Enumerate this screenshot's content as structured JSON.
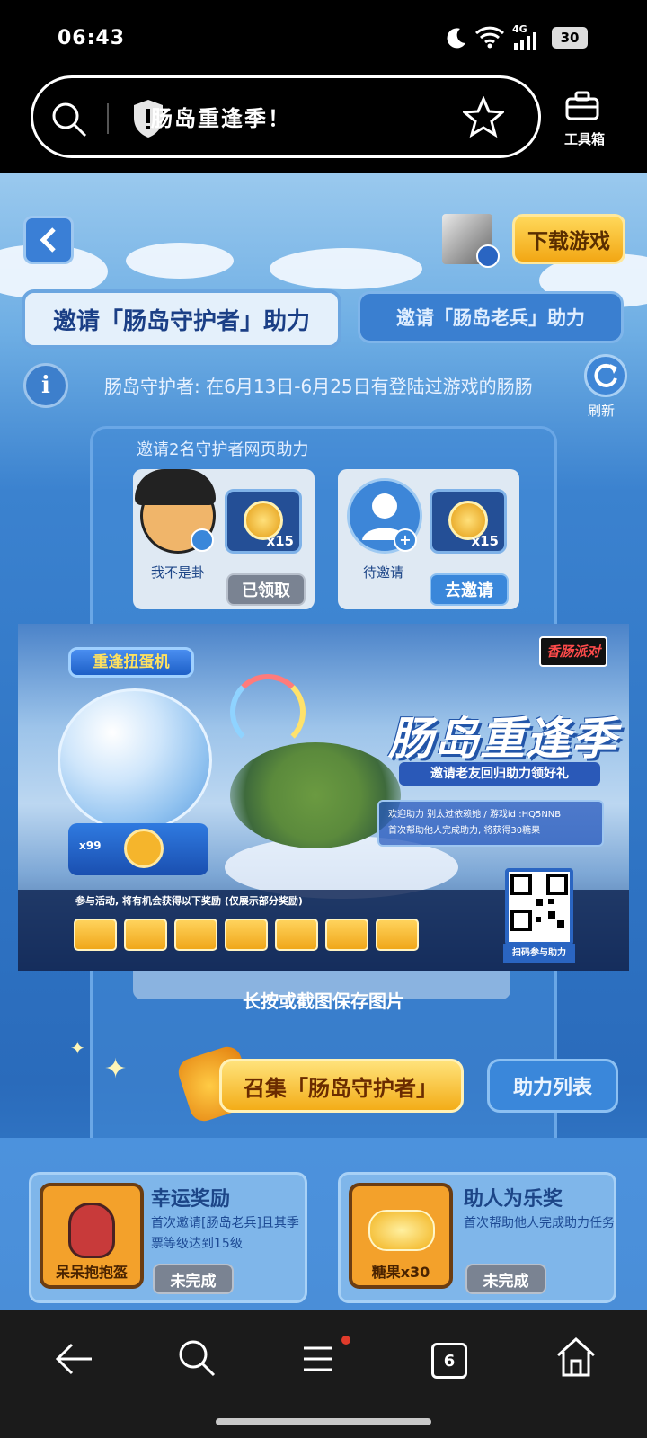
{
  "status_bar": {
    "time": "06:43",
    "network": "4G",
    "battery": "30"
  },
  "browser": {
    "address_text": "肠岛重逢季！",
    "toolbox_label": "工具箱"
  },
  "header": {
    "download_label": "下载游戏"
  },
  "tabs": [
    {
      "label": "邀请「肠岛守护者」助力",
      "active": true
    },
    {
      "label": "邀请「肠岛老兵」助力",
      "active": false
    }
  ],
  "info": {
    "text": "肠岛守护者: 在6月13日-6月25日有登陆过游戏的肠肠",
    "refresh_label": "刷新"
  },
  "invite_card": {
    "title": "邀请2名守护者网页助力",
    "slots": [
      {
        "name": "我不是卦",
        "reward_count": "x15",
        "button": "已领取",
        "done": true
      },
      {
        "name": "待邀请",
        "reward_count": "x15",
        "button": "去邀请",
        "done": false
      }
    ],
    "save_hint": "长按或截图保存图片"
  },
  "poster": {
    "logo": "香肠派对",
    "title": "肠岛重逢季",
    "subtitle": "邀请老友回归助力领好礼",
    "info_line1": "欢迎助力 别太过依赖她 / 游戏id :HQ5NNB",
    "info_line2": "首次帮助他人完成助力, 将获得30糖果",
    "gacha_label": "重逢扭蛋机",
    "gacha_counter": "x99",
    "rewards_note": "参与活动, 将有机会获得以下奖励 (仅展示部分奖励)",
    "qr_label": "扫码参与助力"
  },
  "actions": {
    "gather_label": "召集「肠岛守护者」",
    "help_list_label": "助力列表"
  },
  "bonus_panels": [
    {
      "title": "幸运奖励",
      "prize_label": "呆呆抱抱盔",
      "description": "首次邀请[肠岛老兵]且其季票等级达到15级",
      "status": "未完成"
    },
    {
      "title": "助人为乐奖",
      "prize_label": "糖果x30",
      "description": "首次帮助他人完成助力任务",
      "status": "未完成"
    }
  ],
  "nav": {
    "tab_count": "6"
  },
  "colors": {
    "accent_yellow": "#f3ad18",
    "primary_blue": "#2f74c4",
    "disabled_gray": "#7a8392"
  }
}
